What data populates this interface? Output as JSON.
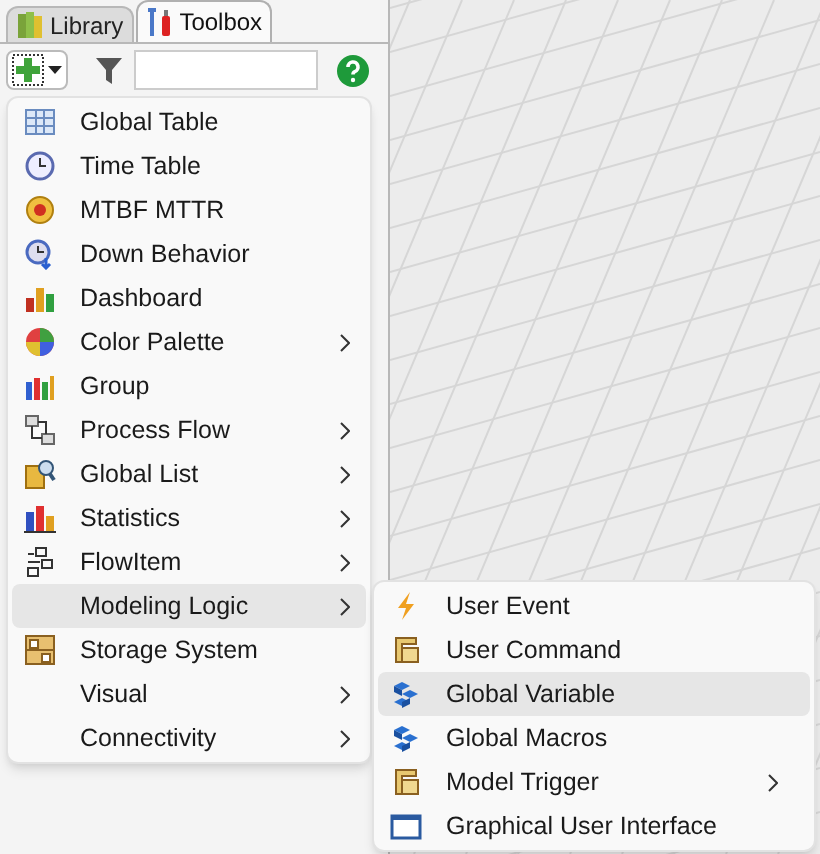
{
  "tabs": [
    {
      "label": "Library",
      "selected": false
    },
    {
      "label": "Toolbox",
      "selected": true
    }
  ],
  "menu": {
    "items": [
      {
        "label": "Global Table",
        "submenu": false,
        "selected": false
      },
      {
        "label": "Time Table",
        "submenu": false,
        "selected": false
      },
      {
        "label": "MTBF MTTR",
        "submenu": false,
        "selected": false
      },
      {
        "label": "Down Behavior",
        "submenu": false,
        "selected": false
      },
      {
        "label": "Dashboard",
        "submenu": false,
        "selected": false
      },
      {
        "label": "Color Palette",
        "submenu": true,
        "selected": false
      },
      {
        "label": "Group",
        "submenu": false,
        "selected": false
      },
      {
        "label": "Process Flow",
        "submenu": true,
        "selected": false
      },
      {
        "label": "Global List",
        "submenu": true,
        "selected": false
      },
      {
        "label": "Statistics",
        "submenu": true,
        "selected": false
      },
      {
        "label": "FlowItem",
        "submenu": true,
        "selected": false
      },
      {
        "label": "Modeling Logic",
        "submenu": true,
        "selected": true
      },
      {
        "label": "Storage System",
        "submenu": false,
        "selected": false
      },
      {
        "label": "Visual",
        "submenu": true,
        "selected": false
      },
      {
        "label": "Connectivity",
        "submenu": true,
        "selected": false
      }
    ]
  },
  "submenu": {
    "items": [
      {
        "label": "User Event",
        "submenu": false,
        "selected": false
      },
      {
        "label": "User Command",
        "submenu": false,
        "selected": false
      },
      {
        "label": "Global Variable",
        "submenu": false,
        "selected": true
      },
      {
        "label": "Global Macros",
        "submenu": false,
        "selected": false
      },
      {
        "label": "Model Trigger",
        "submenu": true,
        "selected": false
      },
      {
        "label": "Graphical User Interface",
        "submenu": false,
        "selected": false
      }
    ]
  }
}
